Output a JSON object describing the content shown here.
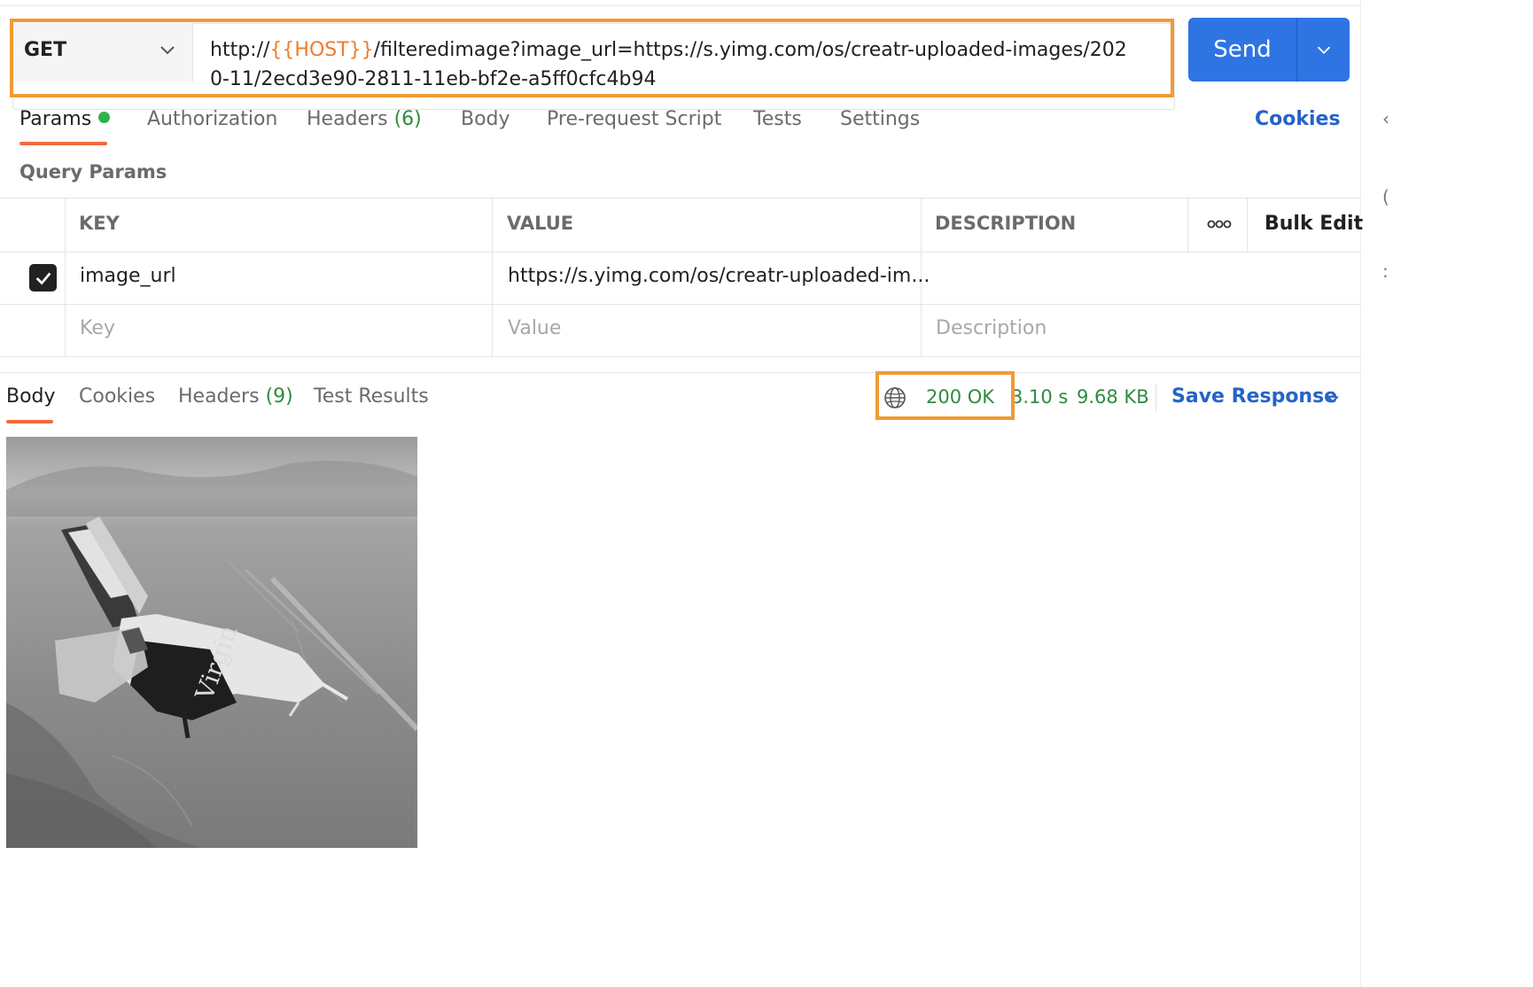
{
  "request": {
    "method": "GET",
    "url_prefix": "http://",
    "url_variable": "{{HOST}}",
    "url_suffix": "/filteredimage?image_url=https://s.yimg.com/os/creatr-uploaded-images/2020-11/2ecd3e90-2811-11eb-bf2e-a5ff0cfc4b94",
    "send_label": "Send"
  },
  "request_tabs": {
    "params": "Params",
    "authorization": "Authorization",
    "headers": "Headers",
    "headers_count": "(6)",
    "body": "Body",
    "prerequest": "Pre-request Script",
    "tests": "Tests",
    "settings": "Settings",
    "cookies": "Cookies"
  },
  "query_params": {
    "title": "Query Params",
    "columns": {
      "key": "KEY",
      "value": "VALUE",
      "description": "DESCRIPTION"
    },
    "bulk_edit": "Bulk Edit",
    "rows": [
      {
        "checked": true,
        "key": "image_url",
        "value": "https://s.yimg.com/os/creatr-uploaded-im...",
        "description": ""
      }
    ],
    "placeholders": {
      "key": "Key",
      "value": "Value",
      "description": "Description"
    }
  },
  "response": {
    "tabs": {
      "body": "Body",
      "cookies": "Cookies",
      "headers": "Headers",
      "headers_count": "(9)",
      "test_results": "Test Results"
    },
    "status": "200 OK",
    "time": "3.10 s",
    "size": "9.68 KB",
    "save_response": "Save Response",
    "image_icon": "grayscale-spaceship-photo-icon"
  },
  "colors": {
    "accent_blue": "#2f74e3",
    "link_blue": "#2563c9",
    "active_tab_orange": "#f26b3a",
    "success_green": "#2e8b3e",
    "variable_orange": "#ef7c2b",
    "highlight_box": "#f09a37"
  }
}
